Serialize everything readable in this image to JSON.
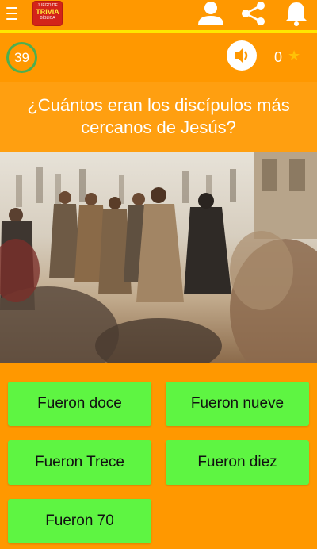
{
  "app": {
    "logo_lines": [
      "JUEGO DE",
      "TRIVIA",
      "BÍBLICA"
    ]
  },
  "toolbar": {
    "icons": [
      "menu-icon",
      "profile-icon",
      "share-icon",
      "notifications-icon"
    ]
  },
  "status": {
    "timer": "39",
    "score": "0",
    "colors": {
      "timer_ring": "#4caf50",
      "star": "#ffc107"
    }
  },
  "question": {
    "text": "¿Cuántos eran los discípulos más cercanos de Jesús?"
  },
  "answers": [
    {
      "label": "Fueron doce"
    },
    {
      "label": "Fueron nueve"
    },
    {
      "label": "Fueron Trece"
    },
    {
      "label": "Fueron diez"
    },
    {
      "label": "Fueron 70"
    }
  ],
  "colors": {
    "background": "#ff9800",
    "answer_button": "#5ef542",
    "divider": "#ffe600"
  }
}
